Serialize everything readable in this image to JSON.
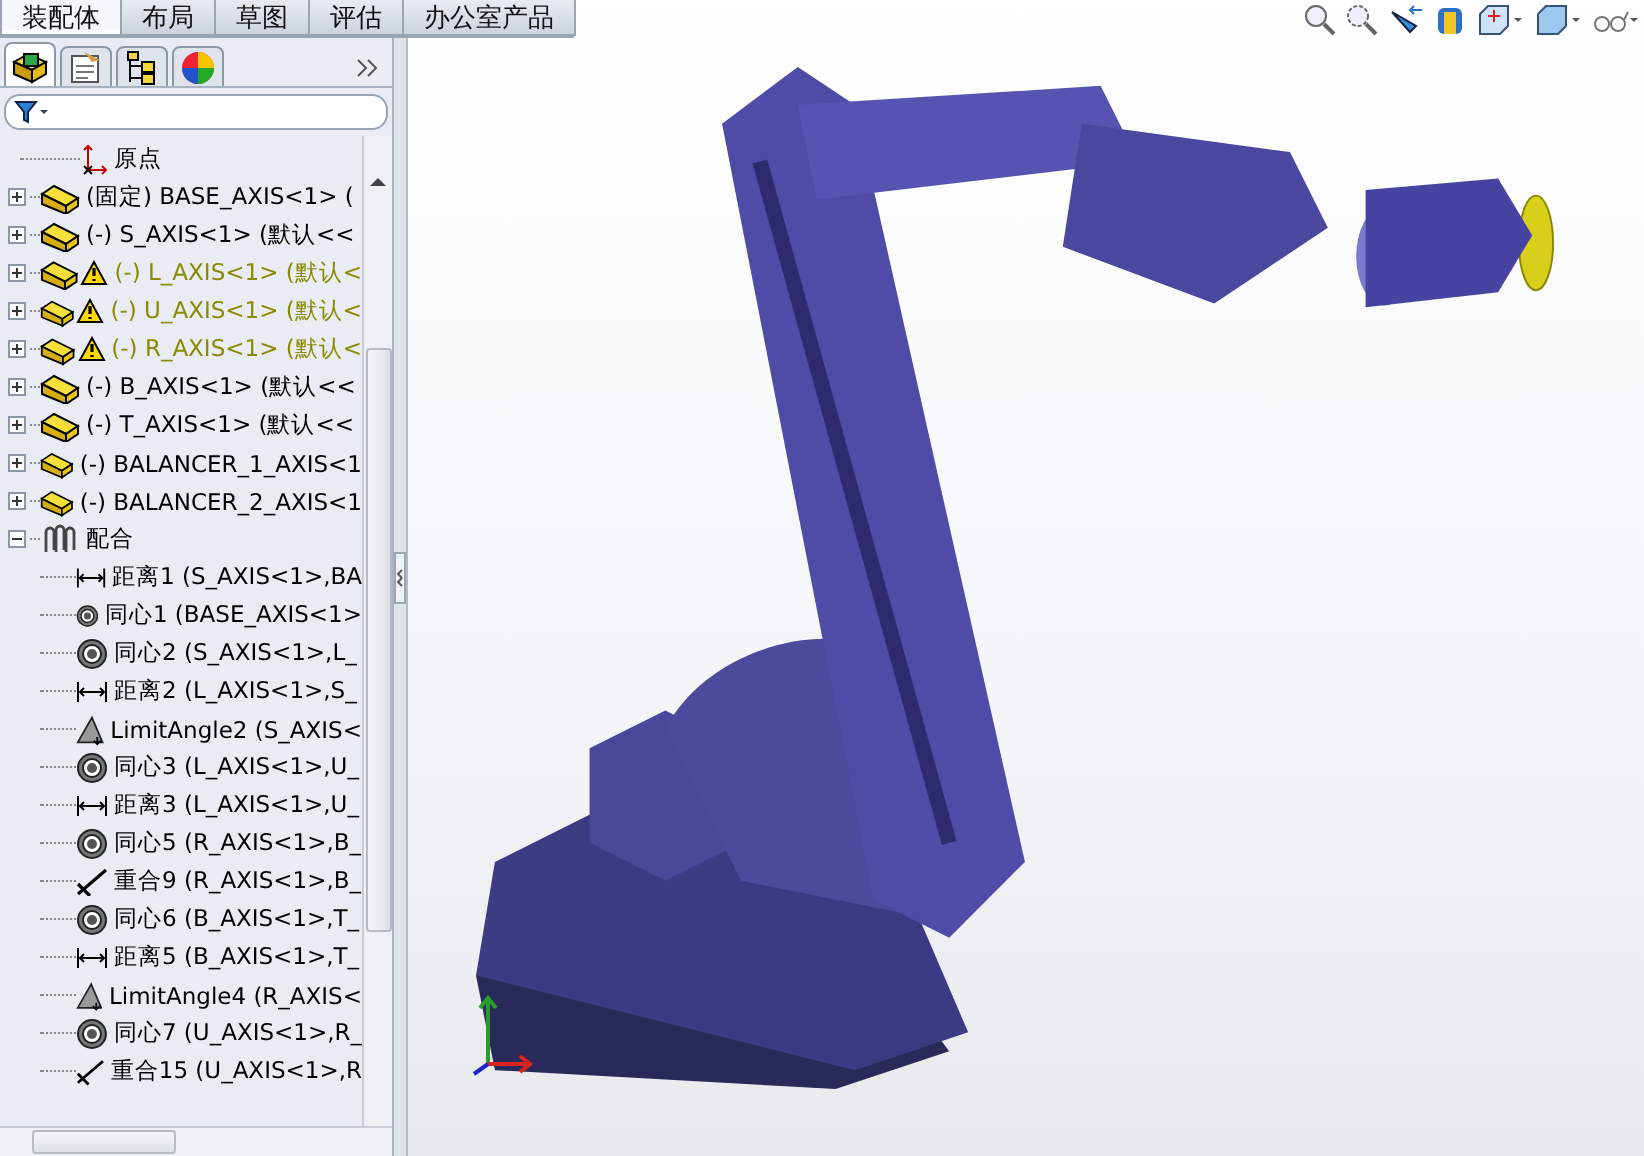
{
  "command_tabs": [
    {
      "label": "装配体",
      "selected": true
    },
    {
      "label": "布局",
      "selected": false
    },
    {
      "label": "草图",
      "selected": false
    },
    {
      "label": "评估",
      "selected": false
    },
    {
      "label": "办公室产品",
      "selected": false
    }
  ],
  "panel_tabs": [
    {
      "kind": "feature",
      "selected": true
    },
    {
      "kind": "property",
      "selected": false
    },
    {
      "kind": "config",
      "selected": false
    },
    {
      "kind": "appearance",
      "selected": false
    }
  ],
  "tree": [
    {
      "kind": "origin",
      "label": "原点"
    },
    {
      "kind": "part",
      "label": "(固定) BASE_AXIS<1> (",
      "warning": false,
      "expanded": false
    },
    {
      "kind": "part",
      "label": "(-) S_AXIS<1> (默认<<",
      "warning": false,
      "expanded": false
    },
    {
      "kind": "part",
      "label": "(-) L_AXIS<1> (默认<",
      "warning": true,
      "expanded": false
    },
    {
      "kind": "part",
      "label": "(-) U_AXIS<1> (默认<",
      "warning": true,
      "expanded": false
    },
    {
      "kind": "part",
      "label": "(-) R_AXIS<1> (默认<",
      "warning": true,
      "expanded": false
    },
    {
      "kind": "part",
      "label": "(-) B_AXIS<1> (默认<<",
      "warning": false,
      "expanded": false
    },
    {
      "kind": "part",
      "label": "(-) T_AXIS<1> (默认<<",
      "warning": false,
      "expanded": false
    },
    {
      "kind": "part",
      "label": "(-) BALANCER_1_AXIS<1",
      "warning": false,
      "expanded": false
    },
    {
      "kind": "part",
      "label": "(-) BALANCER_2_AXIS<1",
      "warning": false,
      "expanded": false
    },
    {
      "kind": "mates",
      "label": "配合",
      "expanded": true,
      "children": [
        {
          "kind": "distance",
          "label": "距离1 (S_AXIS<1>,BA"
        },
        {
          "kind": "concentric",
          "label": "同心1 (BASE_AXIS<1>"
        },
        {
          "kind": "concentric",
          "label": "同心2 (S_AXIS<1>,L_"
        },
        {
          "kind": "distance",
          "label": "距离2 (L_AXIS<1>,S_"
        },
        {
          "kind": "limitangle",
          "label": "LimitAngle2 (S_AXIS<"
        },
        {
          "kind": "concentric",
          "label": "同心3 (L_AXIS<1>,U_"
        },
        {
          "kind": "distance",
          "label": "距离3 (L_AXIS<1>,U_"
        },
        {
          "kind": "concentric",
          "label": "同心5 (R_AXIS<1>,B_"
        },
        {
          "kind": "coincident",
          "label": "重合9 (R_AXIS<1>,B_"
        },
        {
          "kind": "concentric",
          "label": "同心6 (B_AXIS<1>,T_"
        },
        {
          "kind": "distance",
          "label": "距离5 (B_AXIS<1>,T_"
        },
        {
          "kind": "limitangle",
          "label": "LimitAngle4 (R_AXIS<"
        },
        {
          "kind": "concentric",
          "label": "同心7 (U_AXIS<1>,R_"
        },
        {
          "kind": "coincident",
          "label": "重合15 (U_AXIS<1>,R"
        }
      ]
    }
  ]
}
